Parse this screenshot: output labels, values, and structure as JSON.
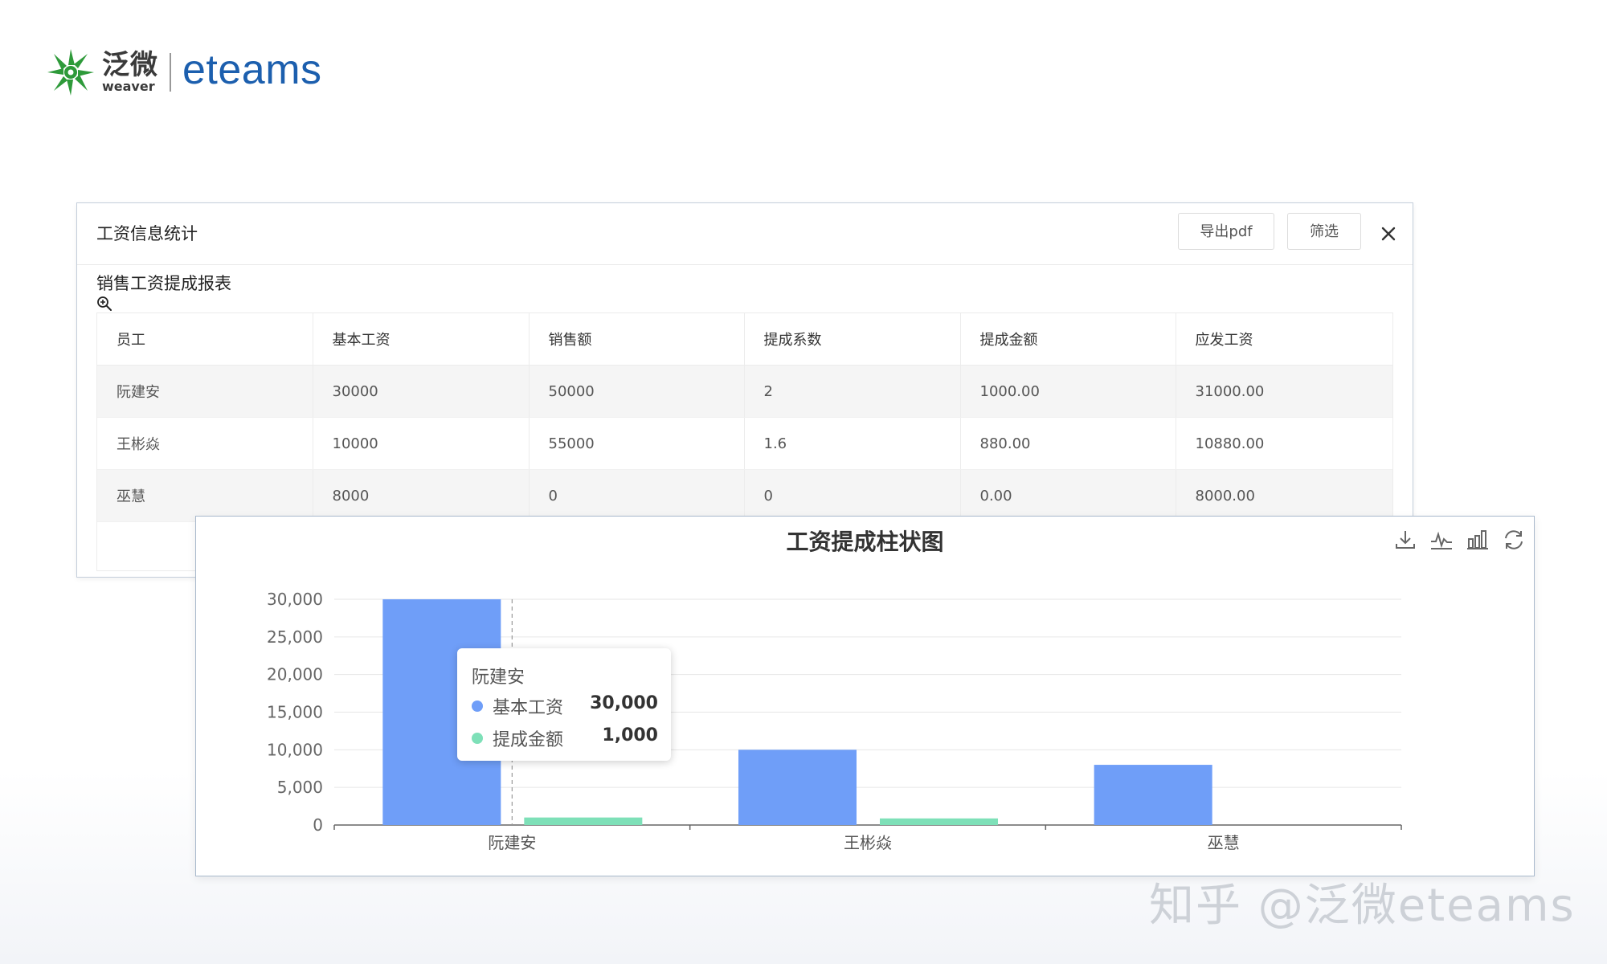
{
  "brand": {
    "name_cn": "泛微",
    "name_en_small": "weaver",
    "product": "eteams",
    "colors": {
      "green": "#2e9a3a",
      "blue": "#1c5fae"
    }
  },
  "report_window": {
    "title": "工资信息统计",
    "export_button": "导出pdf",
    "filter_button": "筛选",
    "close_icon": "close-icon",
    "report_title": "销售工资提成报表",
    "zoom_icon": "zoom-in-icon",
    "table": {
      "columns": [
        "员工",
        "基本工资",
        "销售额",
        "提成系数",
        "提成金额",
        "应发工资"
      ],
      "rows": [
        [
          "阮建安",
          "30000",
          "50000",
          "2",
          "1000.00",
          "31000.00"
        ],
        [
          "王彬焱",
          "10000",
          "55000",
          "1.6",
          "880.00",
          "10880.00"
        ],
        [
          "巫慧",
          "8000",
          "0",
          "0",
          "0.00",
          "8000.00"
        ]
      ]
    }
  },
  "chart_window": {
    "toolbox_icons": [
      "download-icon",
      "line-chart-icon",
      "bar-chart-icon",
      "refresh-icon"
    ],
    "tooltip": {
      "title": "阮建安",
      "rows": [
        {
          "name": "基本工资",
          "value": "30,000"
        },
        {
          "name": "提成金额",
          "value": "1,000"
        }
      ]
    }
  },
  "chart_data": {
    "type": "bar",
    "title": "工资提成柱状图",
    "categories": [
      "阮建安",
      "王彬焱",
      "巫慧"
    ],
    "series": [
      {
        "name": "基本工资",
        "values": [
          30000,
          10000,
          8000
        ],
        "color": "#6f9ef8"
      },
      {
        "name": "提成金额",
        "values": [
          1000,
          880,
          0
        ],
        "color": "#7ee0b8"
      }
    ],
    "ylim": [
      0,
      30000
    ],
    "yticks": [
      "0",
      "5,000",
      "10,000",
      "15,000",
      "20,000",
      "25,000",
      "30,000"
    ],
    "grid": true,
    "legend": "none"
  },
  "watermark": "知乎 @泛微eteams"
}
